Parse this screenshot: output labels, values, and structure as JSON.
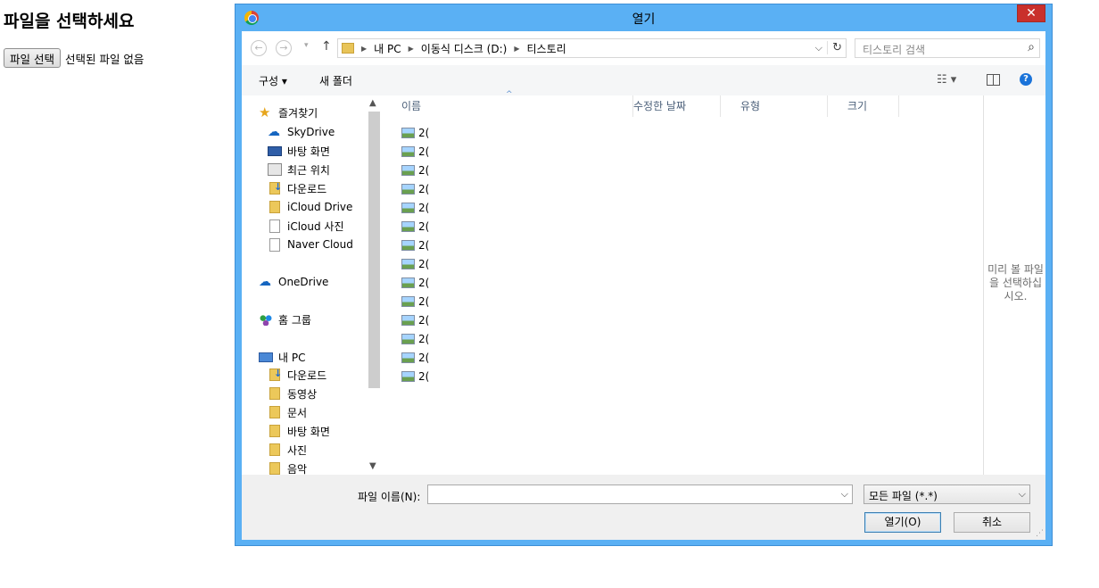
{
  "page": {
    "title": "파일을 선택하세요",
    "file_button": "파일 선택",
    "file_status": "선택된 파일 없음"
  },
  "dialog": {
    "title": "열기",
    "close_label": "✕",
    "nav": {
      "back": "←",
      "forward": "→",
      "recent": "▾",
      "up": "↑"
    },
    "breadcrumb": [
      "내 PC",
      "이동식 디스크 (D:)",
      "티스토리"
    ],
    "search_placeholder": "티스토리 검색",
    "toolbar": {
      "organize": "구성 ▾",
      "new_folder": "새 폴더",
      "help": "?"
    },
    "sidebar": {
      "favorites": "즐겨찾기",
      "favorites_items": [
        "SkyDrive",
        "바탕 화면",
        "최근 위치",
        "다운로드",
        "iCloud Drive",
        "iCloud 사진",
        "Naver Cloud"
      ],
      "onedrive": "OneDrive",
      "homegroup": "홈 그룹",
      "this_pc": "내 PC",
      "pc_items": [
        "다운로드",
        "동영상",
        "문서",
        "바탕 화면",
        "사진",
        "음악"
      ]
    },
    "columns": {
      "name": "이름",
      "modified": "수정한 날짜",
      "type": "유형",
      "size": "크기"
    },
    "files": [
      "2(",
      "2(",
      "2(",
      "2(",
      "2(",
      "2(",
      "2(",
      "2(",
      "2(",
      "2(",
      "2(",
      "2(",
      "2(",
      "2("
    ],
    "preview_text": "미리 볼 파일을 선택하십시오.",
    "filename_label": "파일 이름(N):",
    "filename_value": "",
    "filter": "모든 파일 (*.*)",
    "open_button": "열기(O)",
    "cancel_button": "취소"
  },
  "colors": {
    "frame": "#5ab0f4",
    "close": "#c9302c",
    "link": "#4c607a"
  }
}
